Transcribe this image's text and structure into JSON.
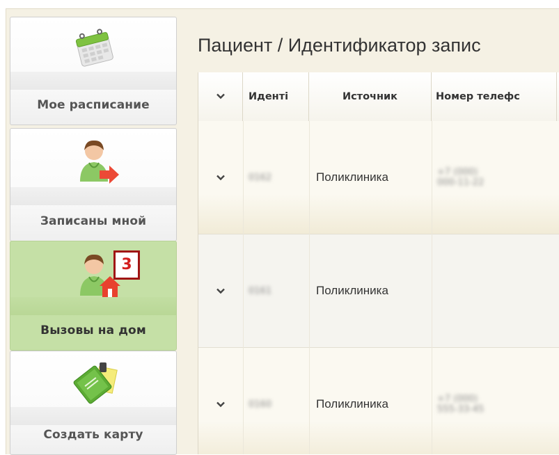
{
  "sidebar": {
    "items": [
      {
        "label": "Мое расписание",
        "icon": "calendar-icon",
        "active": false
      },
      {
        "label": "Записаны мной",
        "icon": "doctor-arrow-icon",
        "active": false
      },
      {
        "label": "Вызовы на дом",
        "icon": "doctor-home-icon",
        "active": true,
        "badge": "3"
      },
      {
        "label": "Создать карту",
        "icon": "medical-card-icon",
        "active": false
      }
    ]
  },
  "main": {
    "title": "Пациент / Идентификатор запис",
    "table": {
      "columns": [
        "",
        "Иденті",
        "Источник",
        "Номер телефс"
      ],
      "rows": [
        {
          "id": "0162",
          "source": "Поликлиника",
          "phone": "+7 (000) 000-11-22"
        },
        {
          "id": "0161",
          "source": "Поликлиника",
          "phone": ""
        },
        {
          "id": "0160",
          "source": "Поликлиника",
          "phone": "+7 (000) 555-33-45"
        }
      ]
    }
  },
  "colors": {
    "active_bg": "#c5e0a6",
    "badge": "#a01414",
    "page_bg": "#f5f1e4"
  }
}
